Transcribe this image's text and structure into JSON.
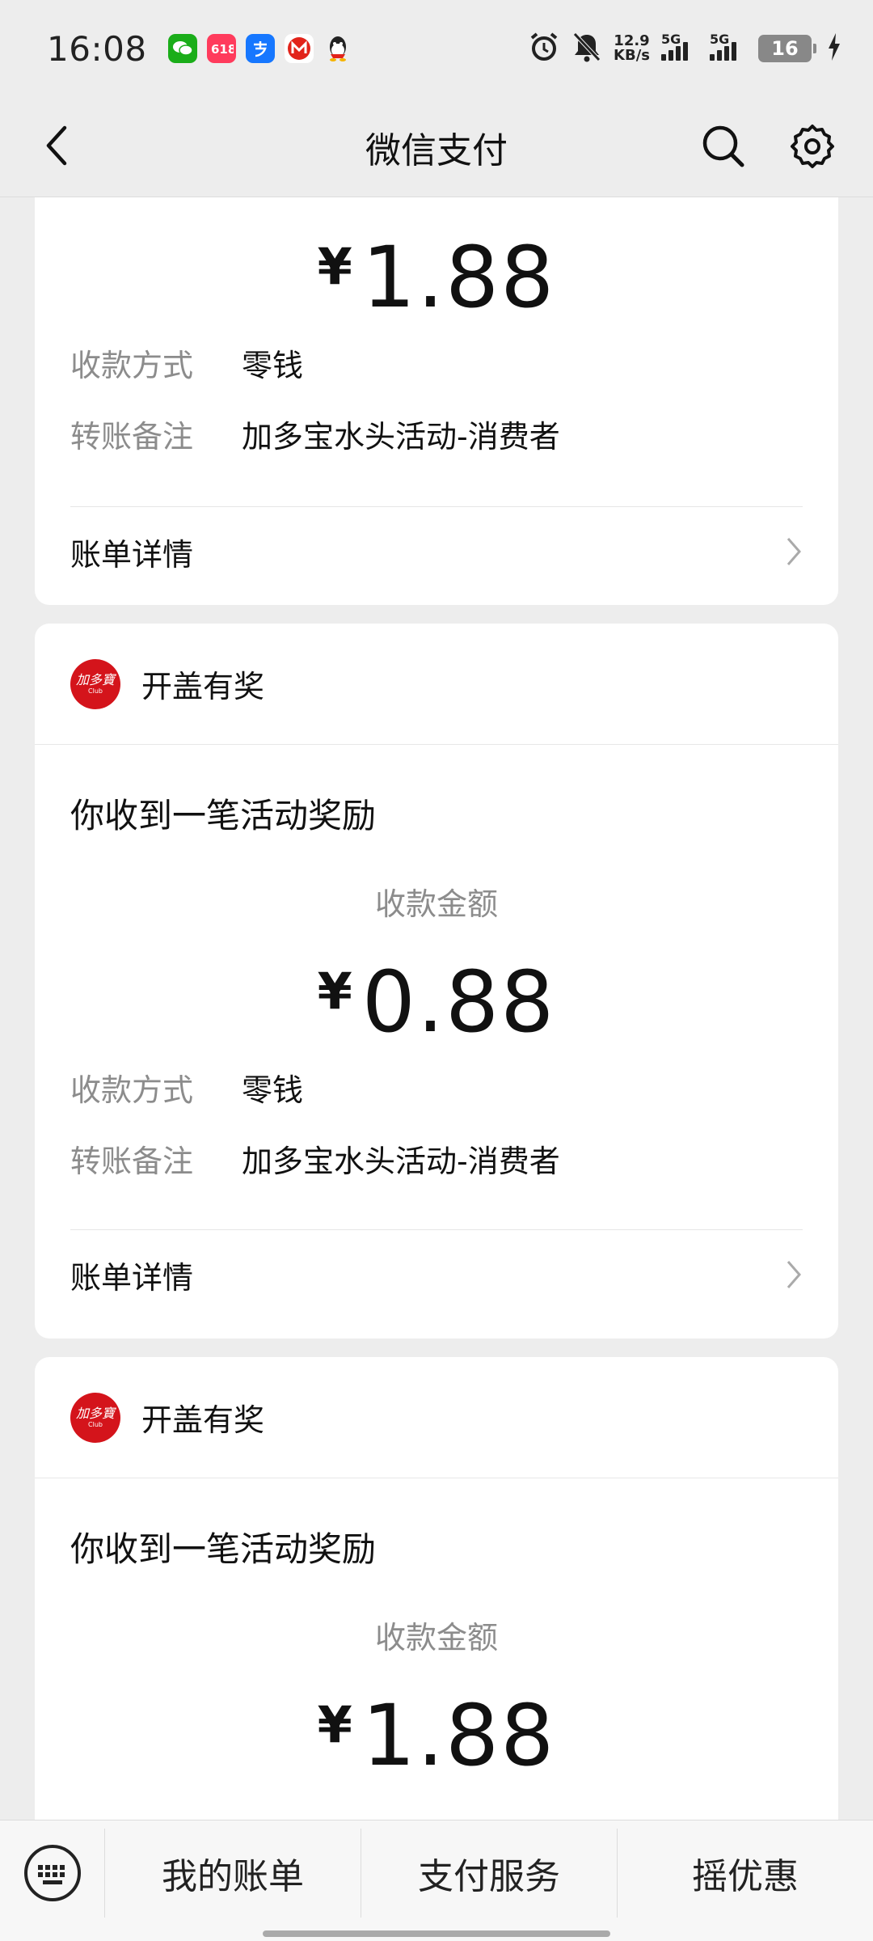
{
  "status_bar": {
    "time": "16:08",
    "net_speed_value": "12.9",
    "net_speed_unit": "KB/s",
    "sig1": "5G",
    "sig2": "5G",
    "battery": "16",
    "apps": [
      {
        "icon": "wechat-icon",
        "color": "#1aad19"
      },
      {
        "icon": "shopping-618-icon",
        "color": "#ff3b5c"
      },
      {
        "icon": "alipay-icon",
        "color": "#1677ff"
      },
      {
        "icon": "metro-icon",
        "color": "#e2231a"
      },
      {
        "icon": "qq-icon",
        "color": "#222222"
      }
    ]
  },
  "header": {
    "title": "微信支付"
  },
  "top_card": {
    "amount": "1.88",
    "currency": "¥",
    "method_label": "收款方式",
    "method_value": "零钱",
    "note_label": "转账备注",
    "note_value": "加多宝水头活动-消费者",
    "detail_label": "账单详情"
  },
  "card2": {
    "logo_text": "加多寶",
    "logo_sub": "Club",
    "sender": "开盖有奖",
    "headline": "你收到一笔活动奖励",
    "amount_label": "收款金额",
    "currency": "¥",
    "amount": "0.88",
    "method_label": "收款方式",
    "method_value": "零钱",
    "note_label": "转账备注",
    "note_value": "加多宝水头活动-消费者",
    "detail_label": "账单详情"
  },
  "card3": {
    "logo_text": "加多寶",
    "logo_sub": "Club",
    "sender": "开盖有奖",
    "headline": "你收到一笔活动奖励",
    "amount_label": "收款金额",
    "currency": "¥",
    "amount": "1.88"
  },
  "bottom_bar": {
    "items": [
      "我的账单",
      "支付服务",
      "摇优惠"
    ]
  },
  "colors": {
    "background": "#ededed",
    "logo_red": "#d4141b"
  }
}
